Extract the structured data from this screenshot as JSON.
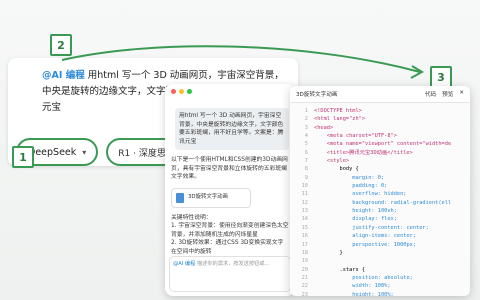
{
  "annotations": {
    "n1": "1",
    "n2": "2",
    "n3": "3"
  },
  "input_panel": {
    "tag": "@AI 编程",
    "prompt": "用html 写一个 3D 动画网页，宇宙深空背景，中央是旋转的边缘文字，文字颜色要五彩斑斓，案是：腾讯元宝",
    "model": "DeepSeek",
    "mode": "R1 · 深度思考"
  },
  "chat": {
    "bubble": "用html 写一个 3D 动画网页，宇宙深空背景，中央是旋转的边缘文字，文字颜色要五彩斑斓，用不好且学等。文案是：腾讯元宝",
    "intro": "以下是一个使用HTML和CSS创建的3D动画网页，具有宇宙深空背景和立体旋转的五彩斑斓文字效果。",
    "file_label": "3D旋转文字动画",
    "notes_title": "关键特性说明：",
    "note1": "1. 宇宙深空背景：使用径向渐变创建深色太空背景，并添加随机生成的闪烁星星",
    "note2": "2. 3D旋转效果：通过CSS 3D变换实现文字在空间中的旋转",
    "footer_tag": "@AI 编程",
    "footer_hint": "描述你的需求，按发送按钮或..."
  },
  "code": {
    "title": "3D旋转文字动画",
    "actions": [
      "代码",
      "预览"
    ],
    "lines": [
      {
        "n": "1",
        "t": "<!DOCTYPE html>"
      },
      {
        "n": "2",
        "t": "<html lang=\"zh\">"
      },
      {
        "n": "3",
        "t": "<head>"
      },
      {
        "n": "4",
        "t": "    <meta charset=\"UTF-8\">"
      },
      {
        "n": "5",
        "t": "    <meta name=\"viewport\" content=\"width=de"
      },
      {
        "n": "6",
        "t": "    <title>腾讯元宝3D动画</title>"
      },
      {
        "n": "7",
        "t": "    <style>"
      },
      {
        "n": "8",
        "t": "        body {"
      },
      {
        "n": "9",
        "t": "            margin: 0;"
      },
      {
        "n": "10",
        "t": "            padding: 0;"
      },
      {
        "n": "11",
        "t": "            overflow: hidden;"
      },
      {
        "n": "12",
        "t": "            background: radial-gradient(ell"
      },
      {
        "n": "13",
        "t": "            height: 100vh;"
      },
      {
        "n": "14",
        "t": "            display: flex;"
      },
      {
        "n": "15",
        "t": "            justify-content: center;"
      },
      {
        "n": "16",
        "t": "            align-items: center;"
      },
      {
        "n": "17",
        "t": "            perspective: 1000px;"
      },
      {
        "n": "18",
        "t": "        }"
      },
      {
        "n": "19",
        "t": ""
      },
      {
        "n": "20",
        "t": "        .stars {"
      },
      {
        "n": "21",
        "t": "            position: absolute;"
      },
      {
        "n": "22",
        "t": "            width: 100%;"
      },
      {
        "n": "23",
        "t": "            height: 100%;"
      }
    ]
  },
  "colors": {
    "accent": "#3a9a54",
    "link": "#2a8ad8"
  }
}
